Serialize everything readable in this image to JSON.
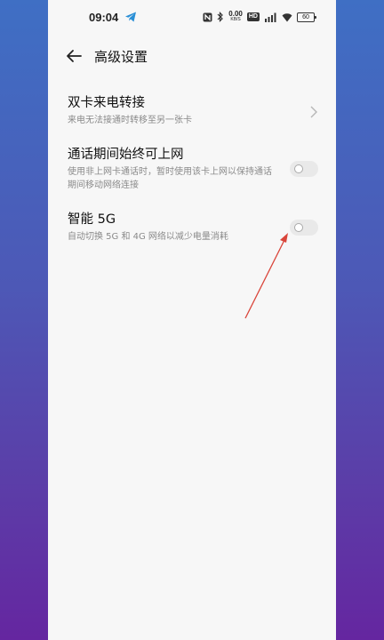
{
  "status_bar": {
    "time": "09:04",
    "net_speed_value": "0.00",
    "net_speed_unit": "KB/S",
    "hd_label": "HD",
    "battery": "60"
  },
  "header": {
    "title": "高级设置"
  },
  "settings": [
    {
      "title": "双卡来电转接",
      "desc": "来电无法接通时转移至另一张卡",
      "control": "chevron"
    },
    {
      "title": "通话期间始终可上网",
      "desc": "使用非上网卡通话时，暂时使用该卡上网以保持通话期间移动网络连接",
      "control": "toggle",
      "enabled": false
    },
    {
      "title": "智能 5G",
      "desc": "自动切换 5G 和 4G 网络以减少电量消耗",
      "control": "toggle",
      "enabled": false
    }
  ],
  "colors": {
    "annotation_arrow": "#d9453a",
    "toggle_off": "#e9e9e9"
  }
}
